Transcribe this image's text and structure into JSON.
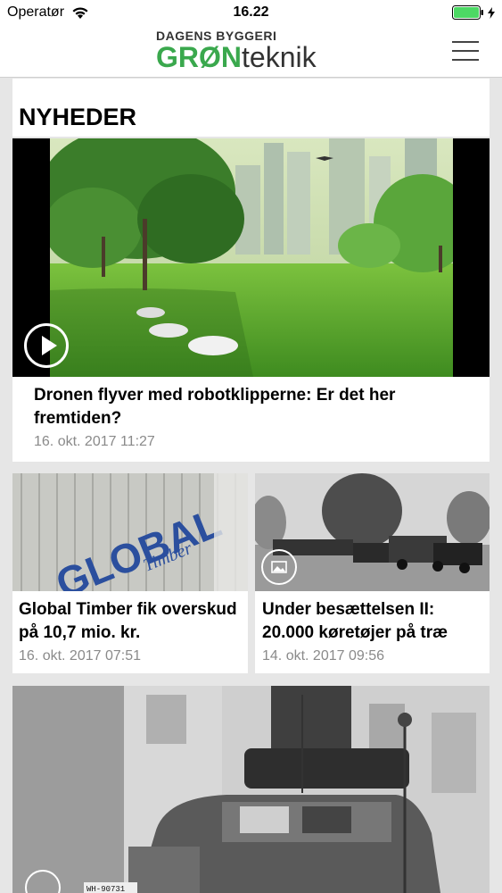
{
  "status_bar": {
    "carrier": "Operatør",
    "time": "16.22"
  },
  "header": {
    "logo_top": "DAGENS BYGGERI",
    "logo_brand": "GRØN",
    "logo_suffix": "teknik"
  },
  "section": {
    "title": "NYHEDER"
  },
  "articles": [
    {
      "title": "Dronen flyver med robotklipperne: Er det her fremtiden?",
      "date": "16. okt. 2017 11:27",
      "media": "video"
    },
    {
      "title": "Global Timber fik overskud på 10,7 mio. kr.",
      "date": "16. okt. 2017 07:51",
      "media": "image",
      "sign_text": "GLOBAL",
      "sign_sub": "Timber"
    },
    {
      "title": "Under besættelsen II: 20.000 køretøjer på træ",
      "date": "14. okt. 2017 09:56",
      "media": "gallery"
    },
    {
      "title": "",
      "date": "",
      "media": "gallery",
      "plate": "WH-90731"
    }
  ],
  "colors": {
    "brand_green": "#3aa84d",
    "battery_green": "#4cd964",
    "date_gray": "#8a8a8a"
  }
}
